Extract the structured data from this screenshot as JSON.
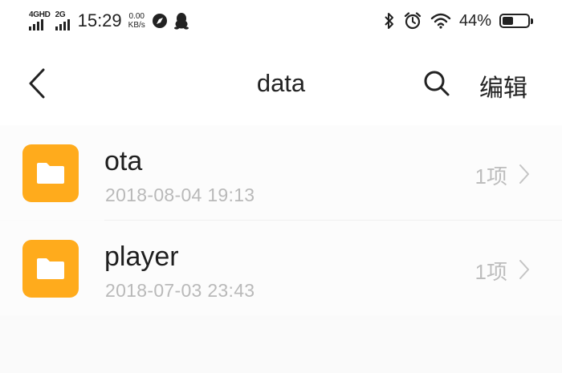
{
  "status_bar": {
    "network_1": "4GHD",
    "network_2": "2G",
    "time": "15:29",
    "speed_value": "0.00",
    "speed_unit": "KB/s",
    "battery_percent": "44%",
    "battery_level": 0.44
  },
  "header": {
    "title": "data",
    "edit_label": "编辑"
  },
  "files": [
    {
      "name": "ota",
      "date": "2018-08-04 19:13",
      "count": "1项"
    },
    {
      "name": "player",
      "date": "2018-07-03 23:43",
      "count": "1项"
    }
  ],
  "colors": {
    "folder": "#ffab1c",
    "secondary_text": "#b9b9b9"
  }
}
